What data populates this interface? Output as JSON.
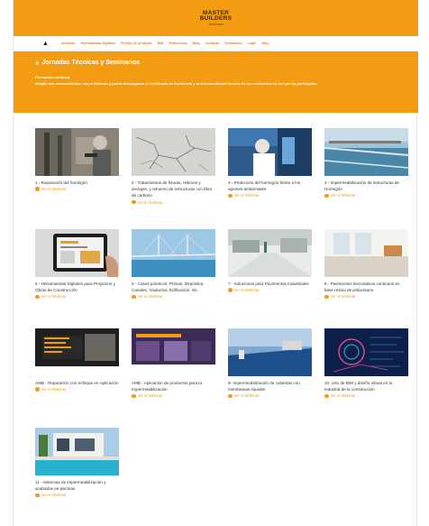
{
  "brand": {
    "line1": "MASTER",
    "line2": "BUILDERS",
    "line3": "SOLUTIONS"
  },
  "nav": {
    "home_icon": "home-icon",
    "items": [
      "Atención",
      "Herramientas digitales",
      "Perfiles de producto",
      "BIM",
      "Referencias",
      "Blog",
      "Contacto",
      "Seminarios",
      "Login",
      "Más..."
    ]
  },
  "hero": {
    "title": "Jornadas Técnicas y Seminarios",
    "subtitle": "Formación continua",
    "description": "Amplíe sus conocimientos, vea el Webinar y podrá descargarse el Certificado de Asistencia y la documentación técnica de los seminarios en los que ha participado.",
    "accent": "#f39c12"
  },
  "cards": [
    {
      "title": "1 - Reparación del hormigón",
      "link": "Ver el Webinar"
    },
    {
      "title": "2 - Tratamientos de fisuras, rellenos y anclajes, y refuerzo de estructuras con fibra de carbono",
      "link": "Ver el Webinar"
    },
    {
      "title": "3 - Protección del hormigón frente a los agentes ambientales.",
      "link": "Ver el Webinar"
    },
    {
      "title": "4 - Impermeabilización de estructuras de Hormigón",
      "link": "Ver el Webinar"
    },
    {
      "title": "5 - Herramientas Digitales para Proyectos y Obras de Construcción",
      "link": "Ver el Webinar"
    },
    {
      "title": "6 - Casos prácticos: Presas, Depósitos, Canales, Viaductos, Edificación, etc.",
      "link": "Ver el Webinar"
    },
    {
      "title": "7 - Soluciones para Pavimentos Industriales",
      "link": "Ver el Webinar"
    },
    {
      "title": "8 - Pavimentos Decorativos continuos en base resina de poliuretano",
      "link": "Ver el Webinar"
    },
    {
      "title": "AMB - Reparación con enfoque en Aplicación",
      "link": "Ver el Webinar"
    },
    {
      "title": "AMB - Aplicación de productos para la Impermeabilización",
      "link": "Ver el Webinar"
    },
    {
      "title": "9- Impermeabilización de cubiertas con membranas líquidas",
      "link": "Ver el Webinar"
    },
    {
      "title": "10- Uso de BIM y diseño virtual en la industria de la construcción",
      "link": "Ver el Webinar"
    },
    {
      "title": "11 - Sistemas de impermeabilización y acabados en piscinas",
      "link": "Ver el Webinar"
    }
  ]
}
